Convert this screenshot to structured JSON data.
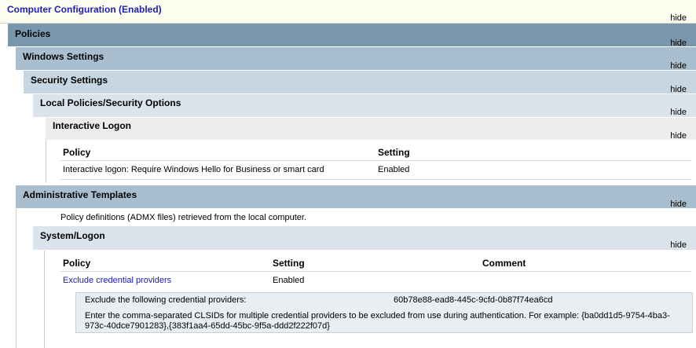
{
  "computer_config": {
    "title": "Computer Configuration (Enabled)",
    "hide": "hide"
  },
  "policies": {
    "title": "Policies",
    "hide": "hide"
  },
  "windows_settings": {
    "title": "Windows Settings",
    "hide": "hide"
  },
  "security_settings": {
    "title": "Security Settings",
    "hide": "hide"
  },
  "local_policies": {
    "title": "Local Policies/Security Options",
    "hide": "hide"
  },
  "interactive_logon": {
    "title": "Interactive Logon",
    "hide": "hide",
    "headers": {
      "policy": "Policy",
      "setting": "Setting"
    },
    "rows": [
      {
        "policy": "Interactive logon: Require Windows Hello for Business or smart card",
        "setting": "Enabled"
      }
    ]
  },
  "admin_templates": {
    "title": "Administrative Templates",
    "hide": "hide",
    "description": "Policy definitions (ADMX files) retrieved from the local computer."
  },
  "system_logon": {
    "title": "System/Logon",
    "hide": "hide",
    "headers": {
      "policy": "Policy",
      "setting": "Setting",
      "comment": "Comment"
    },
    "rows": [
      {
        "policy": "Exclude credential providers",
        "setting": "Enabled",
        "comment": ""
      }
    ],
    "detail": {
      "label": "Exclude the following credential providers:",
      "value": "60b78e88-ead8-445c-9cfd-0b87f74ea6cd",
      "help": "Enter the comma-separated CLSIDs for multiple credential providers to be excluded from use during authentication. For example: {ba0dd1d5-9754-4ba3-973c-40dce7901283},{383f1aa4-65dd-45bc-9f5a-ddd2f222f07d}"
    }
  }
}
